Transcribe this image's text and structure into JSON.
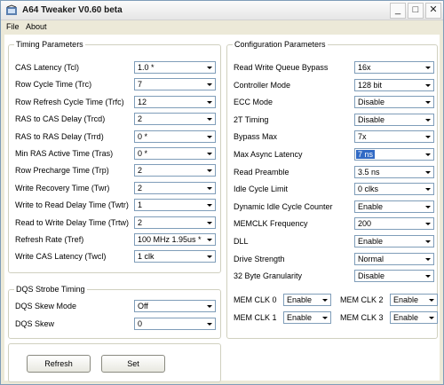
{
  "window": {
    "title": "A64 Tweaker V0.60 beta",
    "icon": "app-logo-icon",
    "controls": {
      "minimize": "_",
      "maximize": "□",
      "close": "✕"
    }
  },
  "menu": [
    "File",
    "About"
  ],
  "timing": {
    "title": "Timing Parameters",
    "rows": [
      {
        "label": "CAS Latency (Tcl)",
        "value": "1.0 *"
      },
      {
        "label": "Row Cycle Time (Trc)",
        "value": "7"
      },
      {
        "label": "Row Refresh Cycle Time (Trfc)",
        "value": "12"
      },
      {
        "label": "RAS to CAS Delay (Trcd)",
        "value": "2"
      },
      {
        "label": "RAS to RAS Delay (Trrd)",
        "value": "0 *"
      },
      {
        "label": "Min RAS Active Time (Tras)",
        "value": "0 *"
      },
      {
        "label": "Row Precharge Time (Trp)",
        "value": "2"
      },
      {
        "label": "Write Recovery Time (Twr)",
        "value": "2"
      },
      {
        "label": "Write to Read Delay Time (Twtr)",
        "value": "1"
      },
      {
        "label": "Read to Write Delay Time (Trtw)",
        "value": "2"
      },
      {
        "label": "Refresh Rate (Tref)",
        "value": "100 MHz 1.95us *"
      },
      {
        "label": "Write CAS Latency (Twcl)",
        "value": "1 clk"
      }
    ]
  },
  "dqs": {
    "title": "DQS Strobe Timing",
    "rows": [
      {
        "label": "DQS Skew Mode",
        "value": "Off"
      },
      {
        "label": "DQS Skew",
        "value": "0"
      }
    ]
  },
  "config": {
    "title": "Configuration Parameters",
    "rows": [
      {
        "label": "Read Write Queue Bypass",
        "value": "16x"
      },
      {
        "label": "Controller Mode",
        "value": "128 bit"
      },
      {
        "label": "ECC Mode",
        "value": "Disable"
      },
      {
        "label": "2T Timing",
        "value": "Disable"
      },
      {
        "label": "Bypass Max",
        "value": "7x"
      },
      {
        "label": "Max Async Latency",
        "value": "7 ns",
        "selected": true
      },
      {
        "label": "Read Preamble",
        "value": "3.5 ns"
      },
      {
        "label": "Idle Cycle Limit",
        "value": "0 clks"
      },
      {
        "label": "Dynamic Idle Cycle Counter",
        "value": "Enable"
      },
      {
        "label": "MEMCLK Frequency",
        "value": "200"
      },
      {
        "label": "DLL",
        "value": "Enable"
      },
      {
        "label": "Drive Strength",
        "value": "Normal"
      },
      {
        "label": "32 Byte Granularity",
        "value": "Disable"
      }
    ]
  },
  "memclk": [
    {
      "label": "MEM CLK 0",
      "value": "Enable"
    },
    {
      "label": "MEM CLK 2",
      "value": "Enable"
    },
    {
      "label": "MEM CLK 1",
      "value": "Enable"
    },
    {
      "label": "MEM CLK 3",
      "value": "Enable"
    }
  ],
  "buttons": {
    "refresh": "Refresh",
    "set": "Set"
  }
}
